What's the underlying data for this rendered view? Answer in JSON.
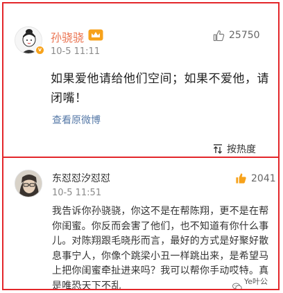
{
  "post": {
    "author": "孙骁骁",
    "time": "10-5 11:11",
    "likes": "25750",
    "content": "如果爱他请给他们空间；如果不爱他，请闭嘴！",
    "view_original": "查看原微博"
  },
  "sort": {
    "label": "按热度"
  },
  "comment": {
    "author": "东怼怼汐怼怼",
    "time": "10-5 11:51",
    "likes": "2041",
    "content": "我告诉你孙骁骁，你这不是在帮陈翔，更不是在帮你闺蜜。你反而会害了他们，也不知道有你什么事儿。对陈翔跟毛晓彤而言，最好的方式是好聚好散息事宁人，你像个跳梁小丑一样跳出来，是希望马上把你闺蜜牵扯进来吗？我可以帮你手动哎特。真是唯恐天下不乱"
  },
  "watermark": {
    "text": "Ye叶公子"
  },
  "colors": {
    "border": "#e3262a",
    "author_name": "#eb7350",
    "link": "#577aa8",
    "like_active": "#f7a21b",
    "time": "#8a8a8a"
  },
  "icons": [
    "thumbs-up-icon",
    "sort-icon",
    "verified-badge-icon",
    "member-badge-icon",
    "wechat-icon"
  ]
}
